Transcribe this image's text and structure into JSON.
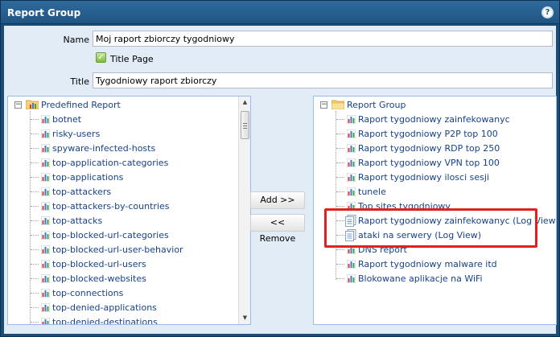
{
  "window": {
    "title": "Report Group",
    "help_icon": "help-icon"
  },
  "form": {
    "name_label": "Name",
    "name_value": "Moj raport zbiorczy tygodniowy",
    "title_page_label": "Title Page",
    "title_page_checked": true,
    "title_label": "Title",
    "title_value": "Tygodniowy raport zbiorczy"
  },
  "left_tree": {
    "root": "Predefined Report",
    "items": [
      "botnet",
      "risky-users",
      "spyware-infected-hosts",
      "top-application-categories",
      "top-applications",
      "top-attackers",
      "top-attackers-by-countries",
      "top-attacks",
      "top-blocked-url-categories",
      "top-blocked-url-user-behavior",
      "top-blocked-url-users",
      "top-blocked-websites",
      "top-connections",
      "top-denied-applications",
      "top-denied-destinations"
    ]
  },
  "buttons": {
    "add": "Add >>",
    "remove": "<< Remove"
  },
  "right_tree": {
    "root": "Report Group",
    "items": [
      {
        "label": "Raport tygodniowy zainfekowanyc",
        "icon": "chart-icon"
      },
      {
        "label": "Raport tygodniowy P2P top 100",
        "icon": "chart-icon"
      },
      {
        "label": "Raport tygodniowy RDP top 250",
        "icon": "chart-icon"
      },
      {
        "label": "Raport tygodniowy VPN top 100",
        "icon": "chart-icon"
      },
      {
        "label": "Raport tygodniowy ilosci sesji",
        "icon": "chart-icon"
      },
      {
        "label": "tunele",
        "icon": "chart-icon"
      },
      {
        "label": "Top sites tygodniowy",
        "icon": "chart-icon"
      },
      {
        "label": "Raport tygodniowy zainfekowanyc (Log View)",
        "icon": "log-view-icon"
      },
      {
        "label": "ataki na serwery (Log View)",
        "icon": "log-view-icon"
      },
      {
        "label": "DNS report",
        "icon": "chart-icon"
      },
      {
        "label": "Raport tygodniowy malware itd",
        "icon": "chart-icon"
      },
      {
        "label": "Blokowane aplikacje na WiFi",
        "icon": "chart-icon"
      }
    ]
  },
  "colors": {
    "titlebar": "#1f5583",
    "highlight": "#e02121",
    "tree_text": "#15428b",
    "panel_bg": "#e1ecf7"
  }
}
